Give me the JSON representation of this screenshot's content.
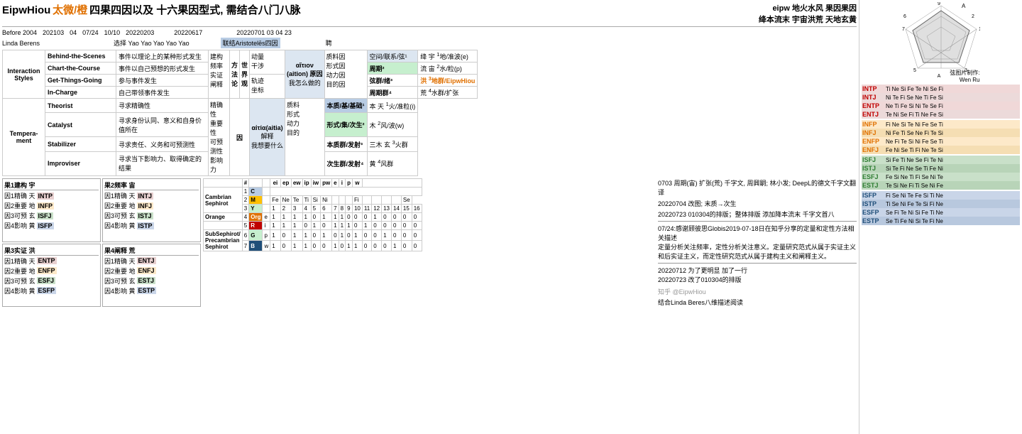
{
  "header": {
    "title_bold": "EipwHiou",
    "title_orange": "太微/橙",
    "title_rest": "四果四因以及 十六果因型式, 需结合八门八脉",
    "top_right_line1": "eipw 地火水风 果因果因",
    "top_right_line2": "绛本流末 宇宙洪荒 天地玄黄",
    "chart_credit": "弦图片制作: Wen Ru"
  },
  "dates": {
    "before2004": "Before 2004",
    "d202103": "202103",
    "d04": "04",
    "d0724": "07/24",
    "d1010": "10/10",
    "d20220203": "20220203",
    "d20220617": "20220617",
    "d20220701": "20220701 03 04 23"
  },
  "linda": "Linda Berens",
  "choose_yao": "选择 Yao Yao Yao Yao Yao",
  "lian_aristoteles": "联结Aristotelēs四因",
  "peng": "聘",
  "interaction_styles": {
    "label": "Interaction Styles",
    "items": [
      {
        "name": "Behind-the-Scenes",
        "desc": "事件以理论上的某种形式发生"
      },
      {
        "name": "Chart-the-Course",
        "desc": "事件以自己预想的形式发生"
      },
      {
        "name": "Get-Things-Going",
        "desc": "参与事件发生"
      },
      {
        "name": "In-Charge",
        "desc": "自己带领事件发生"
      }
    ]
  },
  "build_methods": {
    "label1": "建构",
    "label2": "频率",
    "label3": "实证",
    "label4": "阐释"
  },
  "world_view": {
    "label": "世界观",
    "items": [
      "动量",
      "干涉",
      "轨迹",
      "坐标"
    ]
  },
  "aitia": {
    "main": "αἴτιον (aition) 原因",
    "sub": "我怎么做的",
    "aitia2": "αἰτία(aitia) 解释",
    "sub2": "我想要什么"
  },
  "zhiliao": {
    "items": [
      "质料因",
      "形式因",
      "动力因",
      "目的因"
    ]
  },
  "space_items": {
    "header": "空间/联系/弦¹",
    "items": [
      {
        "num": "绛",
        "label": "宇",
        "sup": "1",
        "desc": "地/准波(e)"
      },
      {
        "num": "流",
        "label": "宙",
        "sup": "2",
        "desc": "水/粒(p)"
      },
      {
        "num": "洪",
        "label": "",
        "sup": "3",
        "desc": "地群/EipwHiou"
      },
      {
        "num": "荒",
        "label": "",
        "sup": "4",
        "desc": "水群/扩张"
      }
    ],
    "zhou2": "周期²",
    "xian3": "弦群/绪³",
    "zhou4": "周期群⁴"
  },
  "ben_items": {
    "ben": "本质/基/基础¹",
    "items": [
      {
        "num": "本",
        "label": "天",
        "sup": "1",
        "desc": "火/准粒(i)"
      },
      {
        "num": "木",
        "label": "",
        "sup": "2",
        "desc": "风/波(w)"
      },
      {
        "num": "三木",
        "label": "玄",
        "sup": "3",
        "desc": "火群"
      },
      {
        "num": "黄",
        "label": "",
        "sup": "4",
        "desc": "风群"
      }
    ],
    "xingshi2": "形式/集/次生²",
    "benz3": "本质群/发射³",
    "cish4": "次生群/发射⁴"
  },
  "temperament": {
    "label": "Tempera­ment",
    "items": [
      {
        "name": "Theorist",
        "desc": "寻求精确性",
        "attr": "精确性"
      },
      {
        "name": "Catalyst",
        "desc": "寻求身份认同、意义和自身价值所在",
        "attr": "重要性"
      },
      {
        "name": "Stabilizer",
        "desc": "寻求责任、义务和可预测性",
        "attr": "可预测性"
      },
      {
        "name": "Improviser",
        "desc": "寻求当下影响力、取得确定的结果",
        "attr": "影响力"
      }
    ]
  },
  "fruit_sections": {
    "f1": {
      "label": "果1建构 宇",
      "items": [
        {
          "yin": "因1精确 天",
          "type": "INTP"
        },
        {
          "yin": "因2重要 地",
          "type": "INFP"
        },
        {
          "yin": "因3可预 玄",
          "type": "ISFJ"
        },
        {
          "yin": "因4影响 黄",
          "type": "ISFP"
        }
      ]
    },
    "f2": {
      "label": "果2频率 宙",
      "items": [
        {
          "yin": "因1精确 天",
          "type": "INTJ"
        },
        {
          "yin": "因2重要 地",
          "type": "INFJ"
        },
        {
          "yin": "因3可预 玄",
          "type": "ISTJ"
        },
        {
          "yin": "因4影响 黄",
          "type": "ISTP"
        }
      ]
    },
    "f3": {
      "label": "果3实证 洪",
      "items": [
        {
          "yin": "因1精确 天",
          "type": "ENTP"
        },
        {
          "yin": "因2重要 地",
          "type": "ENFP"
        },
        {
          "yin": "因3可预 玄",
          "type": "ESFJ"
        },
        {
          "yin": "因4影响 黄",
          "type": "ESFP"
        }
      ]
    },
    "f4": {
      "label": "果4阐释 荒",
      "items": [
        {
          "yin": "因1精确 天",
          "type": "ENTJ"
        },
        {
          "yin": "因2重要 地",
          "type": "ENFJ"
        },
        {
          "yin": "因3可预 玄",
          "type": "ESTJ"
        },
        {
          "yin": "因4影响 黄",
          "type": "ESTP"
        }
      ]
    }
  },
  "sephirot": {
    "rows": [
      {
        "name": "Cambrian Sephirot",
        "num": "1",
        "letter": "C",
        "cols": [
          "",
          "",
          "",
          "",
          "",
          "",
          "",
          "",
          "",
          "",
          "",
          "",
          "",
          "",
          ""
        ]
      },
      {
        "name": "",
        "num": "2",
        "letter": "M",
        "vals": [
          "Fe",
          "Ne",
          "Te",
          "Ti",
          "Si",
          "Ni",
          "",
          "",
          "",
          "Fi",
          "",
          "",
          "",
          "",
          "Se"
        ]
      },
      {
        "name": "",
        "num": "3",
        "letter": "Y",
        "vals": [
          "1",
          "2",
          "3",
          "4",
          "5",
          "6",
          "7",
          "8",
          "9",
          "10",
          "11",
          "12",
          "13",
          "14",
          "15",
          "16"
        ]
      },
      {
        "name": "Orange",
        "num": "4",
        "letter": "Org",
        "prefix": "e",
        "vals": [
          "1",
          "1",
          "1",
          "1",
          "0",
          "1",
          "1",
          "1",
          "0",
          "0",
          "0",
          "1",
          "0",
          "0",
          "0",
          "0"
        ]
      },
      {
        "name": "",
        "num": "5",
        "letter": "R",
        "prefix": "i",
        "vals": [
          "1",
          "1",
          "1",
          "0",
          "1",
          "0",
          "1",
          "1",
          "1",
          "0",
          "1",
          "0",
          "0",
          "0",
          "0",
          "0"
        ]
      },
      {
        "name": "SubSephirot/Precambrian Sephirot",
        "num": "6",
        "letter": "G",
        "prefix": "p",
        "vals": [
          "1",
          "0",
          "1",
          "1",
          "0",
          "1",
          "0",
          "1",
          "0",
          "1",
          "0",
          "0",
          "1",
          "0",
          "0",
          "0"
        ]
      },
      {
        "name": "",
        "num": "7",
        "letter": "B",
        "prefix": "w",
        "vals": [
          "1",
          "0",
          "1",
          "1",
          "0",
          "0",
          "1",
          "0",
          "1",
          "1",
          "0",
          "0",
          "0",
          "1",
          "0",
          "0"
        ]
      }
    ],
    "col_headers": [
      "ei",
      "ep",
      "ew",
      "ip",
      "iw",
      "pw",
      "e",
      "i",
      "p",
      "w"
    ]
  },
  "notes": {
    "note1": "0703 周期(宙) 扩张(荒) 千字文, 周興嗣; 林小发; DeepL的德文千字文翻译",
    "note2": "20220704 改图; 末质→次生",
    "note3": "20220723 010304的排版；整体排版 添加降本流末 千字文首八",
    "note4": "07/24:感谢顾彼思Globis2019-07-18日在知乎分享的定量和定性方法相关描述",
    "note5": "定量分析关注频率，定性分析关注意义。定量研究范式从属于实证主义",
    "note6": "和后实证主义，而定性研究范式从属于建构主义和阐释主义。",
    "note7": "20220712 为了更明显 加了一行",
    "note8": "20220723 改了010304的排版",
    "note9": "结合Linda Beres八维描述阅读"
  },
  "zhihu": "知乎 @EipwHiou",
  "mbti_right": {
    "groups": [
      {
        "color": "#e8d0d0",
        "items": [
          {
            "type": "INTP",
            "funcs": "Ti Ne Si Fe Te Ni Se Fi"
          },
          {
            "type": "INTJ",
            "funcs": "Ni Te Fi Se Ne Ti Fe Si"
          },
          {
            "type": "ENTP",
            "funcs": "Ne Ti Fe Si Ni Te Se Fi"
          },
          {
            "type": "ENTJ",
            "funcs": "Te Ni Se Fi Ti Ne Fe Si"
          }
        ]
      },
      {
        "color": "#fde9c9",
        "items": [
          {
            "type": "INFP",
            "funcs": "Fi Ne Si Te Ni Fe Se Ti"
          },
          {
            "type": "INFJ",
            "funcs": "Ni Fe Ti Se Ne Fi Te Si"
          },
          {
            "type": "ENFP",
            "funcs": "Ne Fi Te Si Ni Fe Se Ti"
          },
          {
            "type": "ENFJ",
            "funcs": "Fe Ni Se Ti Fi Ne Te Si"
          }
        ]
      },
      {
        "color": "#c9e0c9",
        "items": [
          {
            "type": "ISFJ",
            "funcs": "Si Fe Ti Ne Se Fi Te Ni"
          },
          {
            "type": "ISTJ",
            "funcs": "Si Te Fi Ne Se Ti Fe Ni"
          },
          {
            "type": "ESFJ",
            "funcs": "Fe Si Ne Ti Fi Se Ni Te"
          },
          {
            "type": "ESTJ",
            "funcs": "Te Si Ne Fi Ti Se Ni Fe"
          }
        ]
      },
      {
        "color": "#c9d5e8",
        "items": [
          {
            "type": "ISFP",
            "funcs": "Fi Se Ni Te Fe Si Ti Ne"
          },
          {
            "type": "ISTP",
            "funcs": "Ti Se Ni Fe Te Si Fi Ne"
          },
          {
            "type": "ESFP",
            "funcs": "Se Fi Te Ni Si Fe Ti Ne"
          },
          {
            "type": "ESTP",
            "funcs": "Se Ti Fe Ni Si Te Fi Ne"
          }
        ]
      }
    ]
  }
}
